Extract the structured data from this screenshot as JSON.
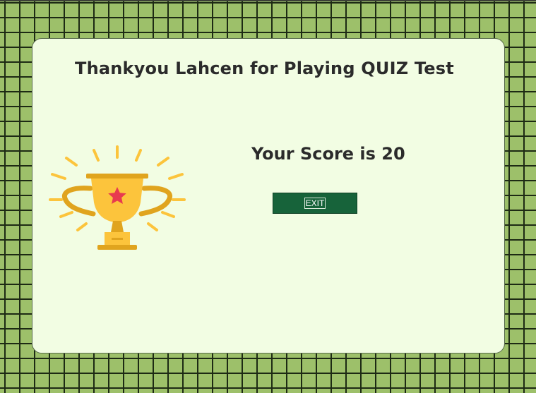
{
  "result": {
    "title": "Thankyou Lahcen for Playing QUIZ Test",
    "score_text": "Your Score is 20",
    "exit_label": "EXIT"
  },
  "icons": {
    "trophy": "trophy-icon"
  },
  "colors": {
    "panel_background": "#f2fde3",
    "grid_background": "#9dc06a",
    "exit_button": "#17633a",
    "trophy_gold": "#fcc43c",
    "trophy_dark_gold": "#e0a41e",
    "star": "#e83a4f"
  }
}
